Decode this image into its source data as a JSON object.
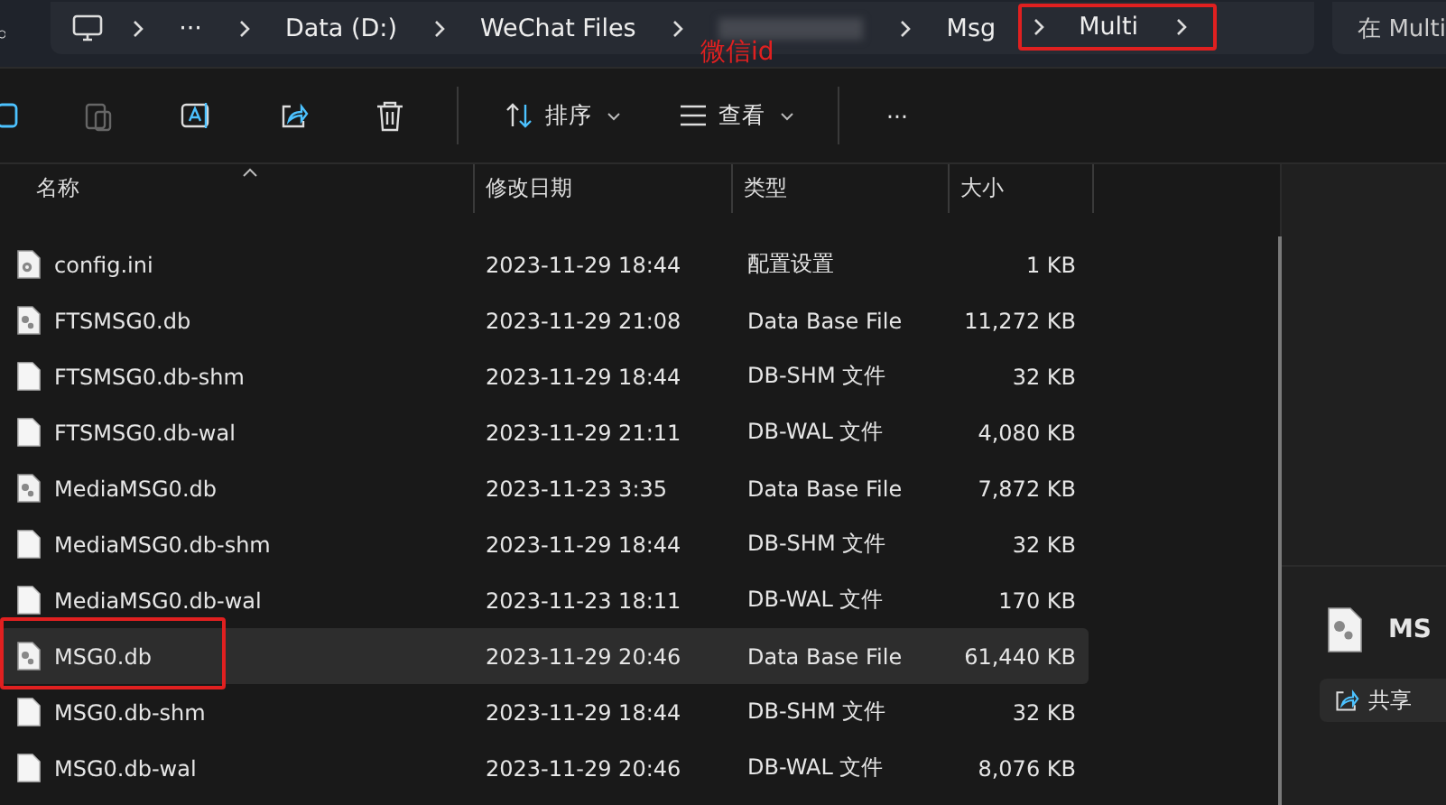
{
  "breadcrumb": {
    "items": [
      {
        "label": "···",
        "kind": "overflow"
      },
      {
        "label": "Data (D:)",
        "kind": "folder"
      },
      {
        "label": "WeChat Files",
        "kind": "folder"
      },
      {
        "kind": "blurred"
      },
      {
        "label": "Msg",
        "kind": "folder"
      },
      {
        "label": "Multi",
        "kind": "current"
      }
    ]
  },
  "search": {
    "placeholder": "在 Multi"
  },
  "annotations": {
    "label": "微信id"
  },
  "toolbar": {
    "items": [
      {
        "kind": "copy",
        "disabled": false
      },
      {
        "kind": "paste",
        "disabled": true
      },
      {
        "kind": "rename",
        "disabled": false
      },
      {
        "kind": "share",
        "disabled": false
      },
      {
        "kind": "delete",
        "disabled": false
      },
      {
        "kind": "sort",
        "label": "排序",
        "disabled": false
      },
      {
        "kind": "view",
        "label": "查看",
        "disabled": false
      },
      {
        "kind": "more",
        "label": "···",
        "disabled": false
      }
    ]
  },
  "table": {
    "columns": [
      "名称",
      "修改日期",
      "类型",
      "大小"
    ],
    "rows": [
      {
        "name": "config.ini",
        "kind": "config",
        "date": "2023-11-29 18:44",
        "type": "配置设置",
        "size": "1 KB",
        "selected": false
      },
      {
        "name": "FTSMSG0.db",
        "kind": "db",
        "date": "2023-11-29 21:08",
        "type": "Data Base File",
        "size": "11,272 KB",
        "selected": false
      },
      {
        "name": "FTSMSG0.db-shm",
        "kind": "blank",
        "date": "2023-11-29 18:44",
        "type": "DB-SHM 文件",
        "size": "32 KB",
        "selected": false
      },
      {
        "name": "FTSMSG0.db-wal",
        "kind": "blank",
        "date": "2023-11-29 21:11",
        "type": "DB-WAL 文件",
        "size": "4,080 KB",
        "selected": false
      },
      {
        "name": "MediaMSG0.db",
        "kind": "db",
        "date": "2023-11-23 3:35",
        "type": "Data Base File",
        "size": "7,872 KB",
        "selected": false
      },
      {
        "name": "MediaMSG0.db-shm",
        "kind": "blank",
        "date": "2023-11-29 18:44",
        "type": "DB-SHM 文件",
        "size": "32 KB",
        "selected": false
      },
      {
        "name": "MediaMSG0.db-wal",
        "kind": "blank",
        "date": "2023-11-23 18:11",
        "type": "DB-WAL 文件",
        "size": "170 KB",
        "selected": false
      },
      {
        "name": "MSG0.db",
        "kind": "db",
        "date": "2023-11-29 20:46",
        "type": "Data Base File",
        "size": "61,440 KB",
        "selected": true
      },
      {
        "name": "MSG0.db-shm",
        "kind": "blank",
        "date": "2023-11-29 18:44",
        "type": "DB-SHM 文件",
        "size": "32 KB",
        "selected": false
      },
      {
        "name": "MSG0.db-wal",
        "kind": "blank",
        "date": "2023-11-29 20:46",
        "type": "DB-WAL 文件",
        "size": "8,076 KB",
        "selected": false
      }
    ]
  },
  "details": {
    "title": "MS",
    "share_button": "共享"
  }
}
